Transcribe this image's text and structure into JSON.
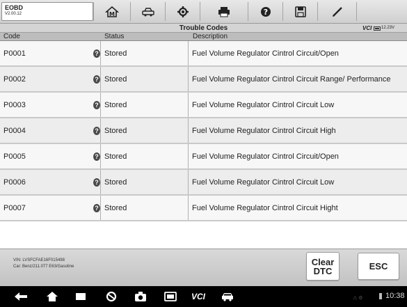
{
  "app": {
    "name": "EOBD",
    "version": "V2.00.12"
  },
  "toolbar": {
    "buttons": [
      {
        "name": "home-icon"
      },
      {
        "name": "vehicle-swap-icon"
      },
      {
        "name": "settings-icon"
      },
      {
        "name": "print-icon"
      },
      {
        "name": "help-icon"
      },
      {
        "name": "save-icon"
      },
      {
        "name": "edit-icon"
      }
    ]
  },
  "titlebar": {
    "title": "Trouble Codes",
    "vci": "VCI",
    "battery": "12.23V"
  },
  "table": {
    "headers": {
      "code": "Code",
      "status": "Status",
      "description": "Description"
    },
    "rows": [
      {
        "code": "P0001",
        "status": "Stored",
        "description": "Fuel Volume Regulator Cintrol Circuit/Open"
      },
      {
        "code": "P0002",
        "status": "Stored",
        "description": "Fuel Volume Regulator Cintrol Circuit Range/ Performance"
      },
      {
        "code": "P0003",
        "status": "Stored",
        "description": "Fuel Volume Regulator Cintrol Circuit Low"
      },
      {
        "code": "P0004",
        "status": "Stored",
        "description": "Fuel Volume Regulator Cintrol Circuit High"
      },
      {
        "code": "P0005",
        "status": "Stored",
        "description": "Fuel Volume Regulator Cintrol Circuit/Open"
      },
      {
        "code": "P0006",
        "status": "Stored",
        "description": "Fuel Volume Regulator Cintrol Circuit Low"
      },
      {
        "code": "P0007",
        "status": "Stored",
        "description": "Fuel Volume Regulator Cintrol Circuit Hight"
      }
    ],
    "help_glyph": "?"
  },
  "vehicle_info": {
    "vin": "VIN: LVSFCFAE16F015498",
    "car": "Car: Benz/211.077 E63/Gasoline"
  },
  "buttons": {
    "clear_dtc": "Clear DTC",
    "esc": "ESC"
  },
  "navbar": {
    "time": "10:38",
    "vci_label": "VCI"
  }
}
